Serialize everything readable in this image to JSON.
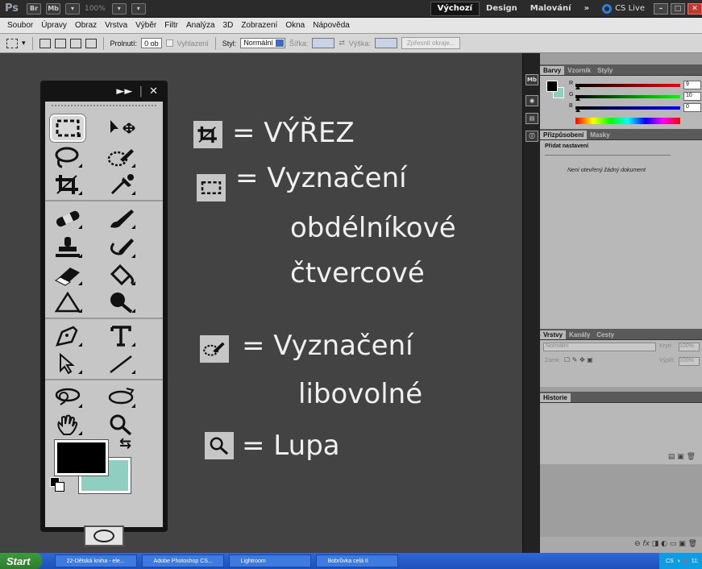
{
  "appbar": {
    "logo": "Ps",
    "br_label": "Br",
    "mb_label": "Mb",
    "zoom": "100%",
    "workspaces": [
      "Výchozí",
      "Design",
      "Malování",
      "»"
    ],
    "cs_live": "CS Live"
  },
  "menu": [
    "Soubor",
    "Úpravy",
    "Obraz",
    "Vrstva",
    "Výběr",
    "Filtr",
    "Analýza",
    "3D",
    "Zobrazení",
    "Okna",
    "Nápověda"
  ],
  "options": {
    "feather_label": "Prolnutí:",
    "feather_value": "0 ob",
    "antialias_label": "Vyhlazení",
    "style_label": "Styl:",
    "style_value": "Normální",
    "width_label": "Šířka:",
    "height_label": "Výška:",
    "refine_button": "Zpřesnit okraje..."
  },
  "tools_header": {
    "expand": "►►",
    "close": "✕"
  },
  "legend": {
    "crop": "= VÝŘEZ",
    "marquee_line1": "= Vyznačení",
    "marquee_line2": "obdélníkové",
    "marquee_line3": "čtvercové",
    "quickselect_line1": "= Vyznačení",
    "quickselect_line2": "libovolné",
    "zoom": "= Lupa"
  },
  "colors_panel": {
    "tabs": [
      "Barvy",
      "Vzorník",
      "Styly"
    ],
    "r_label": "R",
    "g_label": "G",
    "b_label": "B",
    "r_value": "9",
    "g_value": "10",
    "b_value": "0"
  },
  "adjust_panel": {
    "tabs": [
      "Přizpůsobení",
      "Masky"
    ],
    "title": "Přidat nastavení",
    "note": "Není otevřený žádný dokument"
  },
  "layers_panel": {
    "tabs": [
      "Vrstvy",
      "Kanály",
      "Cesty"
    ],
    "blend_mode": "Normální",
    "opacity_label": "Krytí:",
    "opacity_value": "100%",
    "lock_label": "Zamk:",
    "fill_label": "Výplň:",
    "fill_value": "100%"
  },
  "history_panel": {
    "tabs": [
      "Historie"
    ]
  },
  "layer_footer": {
    "fx": "fx"
  },
  "taskbar": {
    "start": "Start",
    "tasks": [
      "22-Dětská kniha - ele...",
      "Adobe Photoshop CS...",
      "Lightroom",
      "Bobrůvka celá II"
    ],
    "tray_cs": "CS",
    "clock": "11:"
  },
  "colors": {
    "foreground": "#000000",
    "background": "#8ecfc2",
    "workspace": "#434343"
  }
}
